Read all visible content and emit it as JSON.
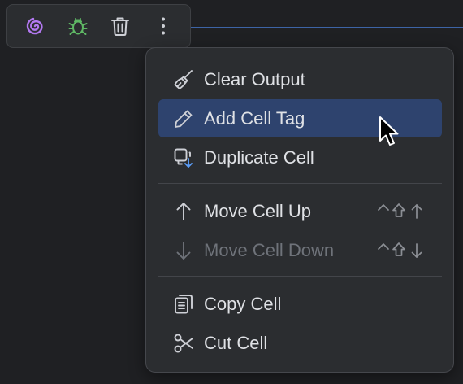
{
  "toolbar": {
    "buttons": [
      {
        "icon": "spiral-icon",
        "color": "#b278f0"
      },
      {
        "icon": "bug-icon",
        "color": "#5fb865"
      },
      {
        "icon": "trash-icon",
        "color": "#ced0d6"
      },
      {
        "icon": "more-vertical-icon",
        "color": "#ced0d6"
      }
    ]
  },
  "menu": {
    "groups": [
      {
        "items": [
          {
            "label": "Clear Output",
            "icon": "broom-icon",
            "state": "normal"
          },
          {
            "label": "Add Cell Tag",
            "icon": "pencil-icon",
            "state": "selected"
          },
          {
            "label": "Duplicate Cell",
            "icon": "duplicate-icon",
            "state": "normal"
          }
        ]
      },
      {
        "items": [
          {
            "label": "Move Cell Up",
            "icon": "arrow-up-icon",
            "state": "normal",
            "shortcut": "⌃⇧↑"
          },
          {
            "label": "Move Cell Down",
            "icon": "arrow-down-icon",
            "state": "disabled",
            "shortcut": "⌃⇧↓"
          }
        ]
      },
      {
        "items": [
          {
            "label": "Copy Cell",
            "icon": "copy-icon",
            "state": "normal"
          },
          {
            "label": "Cut Cell",
            "icon": "scissors-icon",
            "state": "normal"
          }
        ]
      }
    ]
  },
  "colors": {
    "background": "#1f2023",
    "panel": "#2b2d30",
    "selection": "#2e436e",
    "accent": "#3d64a6"
  }
}
